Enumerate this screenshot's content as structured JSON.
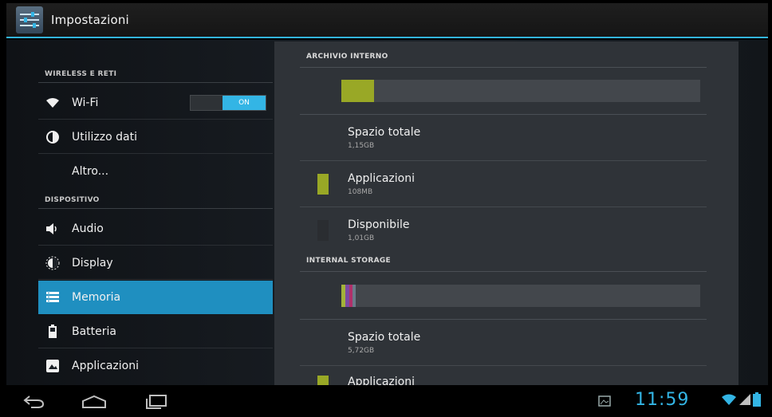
{
  "actionbar": {
    "title": "Impostazioni",
    "icon": "settings-sliders-icon"
  },
  "sidebar": {
    "sections": [
      {
        "header": "WIRELESS E RETI"
      },
      {
        "header": "DISPOSITIVO"
      }
    ],
    "items": [
      {
        "label": "Wi-Fi",
        "icon": "wifi-icon",
        "toggle": "ON"
      },
      {
        "label": "Utilizzo dati",
        "icon": "data-usage-icon"
      },
      {
        "label": "Altro..."
      },
      {
        "label": "Audio",
        "icon": "speaker-icon"
      },
      {
        "label": "Display",
        "icon": "brightness-icon"
      },
      {
        "label": "Memoria",
        "icon": "storage-icon",
        "selected": true
      },
      {
        "label": "Batteria",
        "icon": "battery-icon"
      },
      {
        "label": "Applicazioni",
        "icon": "apps-icon"
      }
    ]
  },
  "storage": {
    "internal_archive": {
      "header": "ARCHIVIO INTERNO",
      "usage_fraction": 0.09,
      "rows": [
        {
          "title": "Spazio totale",
          "value": "1,15GB"
        },
        {
          "title": "Applicazioni",
          "value": "108MB",
          "color": "#99a826"
        },
        {
          "title": "Disponibile",
          "value": "1,01GB",
          "color": "#2a2d31"
        }
      ]
    },
    "internal_storage": {
      "header": "INTERNAL STORAGE",
      "segments": [
        {
          "color": "#a3b23a",
          "fraction": 0.01
        },
        {
          "color": "#7a4aa3",
          "fraction": 0.012
        },
        {
          "color": "#b0306a",
          "fraction": 0.01
        },
        {
          "color": "#6a7a8a",
          "fraction": 0.008
        }
      ],
      "rows": [
        {
          "title": "Spazio totale",
          "value": "5,72GB"
        },
        {
          "title": "Applicazioni",
          "color": "#99a826"
        }
      ]
    }
  },
  "statusbar": {
    "time": "11:59"
  },
  "colors": {
    "accent": "#33b5e5",
    "selected": "#1f8fc0",
    "apps": "#99a826"
  }
}
